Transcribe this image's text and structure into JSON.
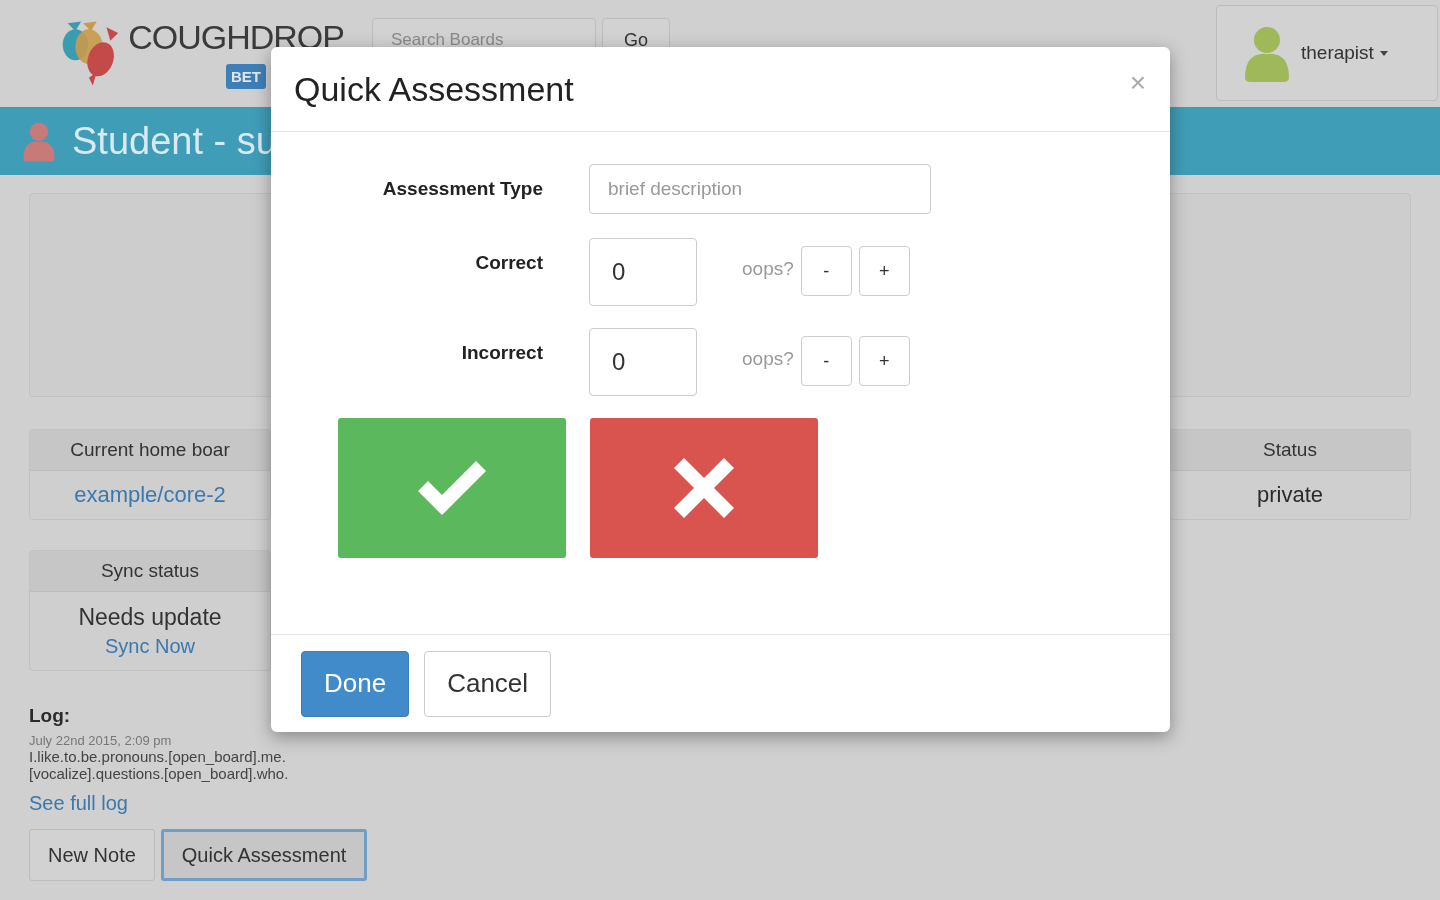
{
  "header": {
    "logo_text": "COUGHDROP",
    "badge": "BET",
    "search": {
      "placeholder": "Search Boards"
    },
    "go_button": "Go",
    "user_menu": {
      "label": "therapist"
    }
  },
  "title_bar": {
    "text": "Student - su"
  },
  "home_board": {
    "heading": "Current home boar",
    "value": "example/core-2"
  },
  "status": {
    "heading": "Status",
    "value": "private"
  },
  "sync": {
    "heading": "Sync status",
    "value": "Needs update",
    "link": "Sync Now"
  },
  "log": {
    "heading": "Log:",
    "date": "July 22nd 2015, 2:09 pm",
    "lines": [
      "I.like.to.be.pronouns.[open_board].me.",
      "[vocalize].questions.[open_board].who."
    ],
    "link": "See full log"
  },
  "actions": [
    {
      "label": "New Note",
      "selected": false
    },
    {
      "label": "Quick Assessment",
      "selected": true
    }
  ],
  "modal": {
    "title": "Quick Assessment",
    "close": "×",
    "fields": [
      {
        "kind": "text",
        "label": "Assessment Type",
        "placeholder": "brief description"
      },
      {
        "kind": "counter",
        "label": "Correct",
        "value": "0",
        "oops": "oops?",
        "minus": "-",
        "plus": "+"
      },
      {
        "kind": "counter",
        "label": "Incorrect",
        "value": "0",
        "oops": "oops?",
        "minus": "-",
        "plus": "+"
      }
    ],
    "big_buttons": [
      {
        "kind": "correct"
      },
      {
        "kind": "incorrect"
      }
    ],
    "footer_buttons": [
      {
        "kind": "primary",
        "label": "Done"
      },
      {
        "kind": "default",
        "label": "Cancel"
      }
    ]
  }
}
